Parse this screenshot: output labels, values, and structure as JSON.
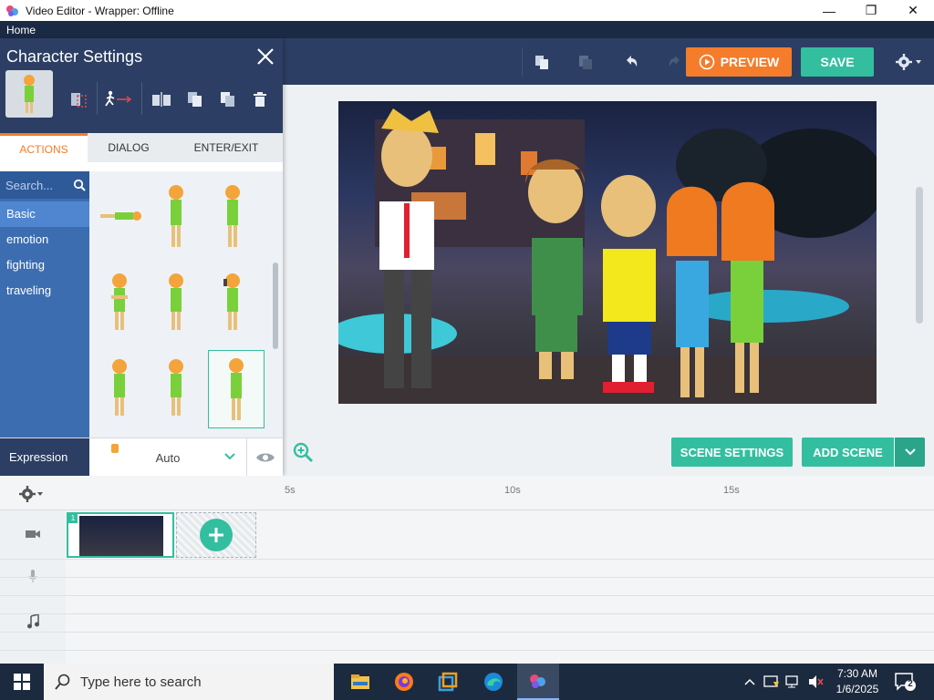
{
  "window": {
    "title": "Video Editor - Wrapper: Offline",
    "minimize": "—",
    "maximize": "❐",
    "close": "✕"
  },
  "menubar": {
    "home": "Home"
  },
  "toolbar": {
    "preview_label": "PREVIEW",
    "save_label": "SAVE"
  },
  "panel": {
    "title": "Character Settings",
    "tabs": [
      {
        "label": "ACTIONS",
        "active": true
      },
      {
        "label": "DIALOG",
        "active": false
      },
      {
        "label": "ENTER/EXIT",
        "active": false
      }
    ],
    "search_placeholder": "Search...",
    "categories": [
      {
        "label": "Basic",
        "active": true
      },
      {
        "label": "emotion",
        "active": false
      },
      {
        "label": "fighting",
        "active": false
      },
      {
        "label": "traveling",
        "active": false
      }
    ],
    "expression_label": "Expression",
    "expression_value": "Auto"
  },
  "stage": {
    "scene_settings_label": "SCENE SETTINGS",
    "add_scene_label": "ADD SCENE"
  },
  "timeline": {
    "ticks": [
      "5s",
      "10s",
      "15s"
    ],
    "scene_number": "1"
  },
  "taskbar": {
    "search_placeholder": "Type here to search",
    "time": "7:30 AM",
    "date": "1/6/2025",
    "notification_count": "2"
  },
  "colors": {
    "accent_orange": "#f47c2a",
    "accent_green": "#33bf9f",
    "header_navy": "#2c3e63",
    "category_blue": "#3c6db0"
  }
}
